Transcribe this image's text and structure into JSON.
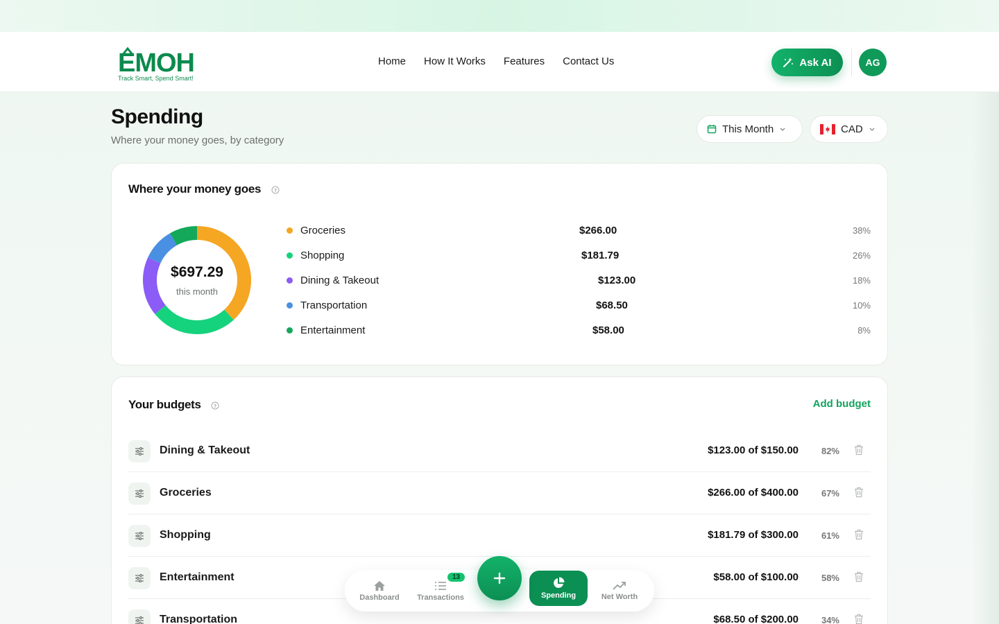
{
  "brand": {
    "logo_text": "EMOH",
    "tagline": "Track Smart, Spend Smart!",
    "color": "#0c8a4d"
  },
  "nav": {
    "items": [
      {
        "label": "Home"
      },
      {
        "label": "How It Works"
      },
      {
        "label": "Features"
      },
      {
        "label": "Contact Us"
      }
    ]
  },
  "header": {
    "ask_ai_label": "Ask AI",
    "avatar_initials": "AG"
  },
  "page": {
    "title": "Spending",
    "subtitle": "Where your money goes, by category"
  },
  "filters": {
    "period": "This Month",
    "currency": "CAD"
  },
  "breakdown": {
    "title": "Where your money goes",
    "total": "$697.29",
    "caption": "this month",
    "items": [
      {
        "name": "Groceries",
        "amount": "$266.00",
        "pct": "38%",
        "value": 266.0,
        "color": "#f5a623"
      },
      {
        "name": "Shopping",
        "amount": "$181.79",
        "pct": "26%",
        "value": 181.79,
        "color": "#15d37d"
      },
      {
        "name": "Dining & Takeout",
        "amount": "$123.00",
        "pct": "18%",
        "value": 123.0,
        "color": "#8b5cf6"
      },
      {
        "name": "Transportation",
        "amount": "$68.50",
        "pct": "10%",
        "value": 68.5,
        "color": "#4a90e2"
      },
      {
        "name": "Entertainment",
        "amount": "$58.00",
        "pct": "8%",
        "value": 58.0,
        "color": "#14a85a"
      }
    ]
  },
  "budgets": {
    "title": "Your budgets",
    "add_label": "Add budget",
    "items": [
      {
        "name": "Dining & Takeout",
        "amount": "$123.00 of $150.00",
        "pct": "82%"
      },
      {
        "name": "Groceries",
        "amount": "$266.00 of $400.00",
        "pct": "67%"
      },
      {
        "name": "Shopping",
        "amount": "$181.79 of $300.00",
        "pct": "61%"
      },
      {
        "name": "Entertainment",
        "amount": "$58.00 of $100.00",
        "pct": "58%"
      },
      {
        "name": "Transportation",
        "amount": "$68.50 of $200.00",
        "pct": "34%"
      }
    ]
  },
  "bottom_nav": {
    "dashboard": "Dashboard",
    "transactions": "Transactions",
    "transactions_badge": "13",
    "spending": "Spending",
    "net_worth": "Net Worth"
  },
  "colors": {
    "accent": "#13a35d",
    "accent_dark": "#0c8f53"
  }
}
